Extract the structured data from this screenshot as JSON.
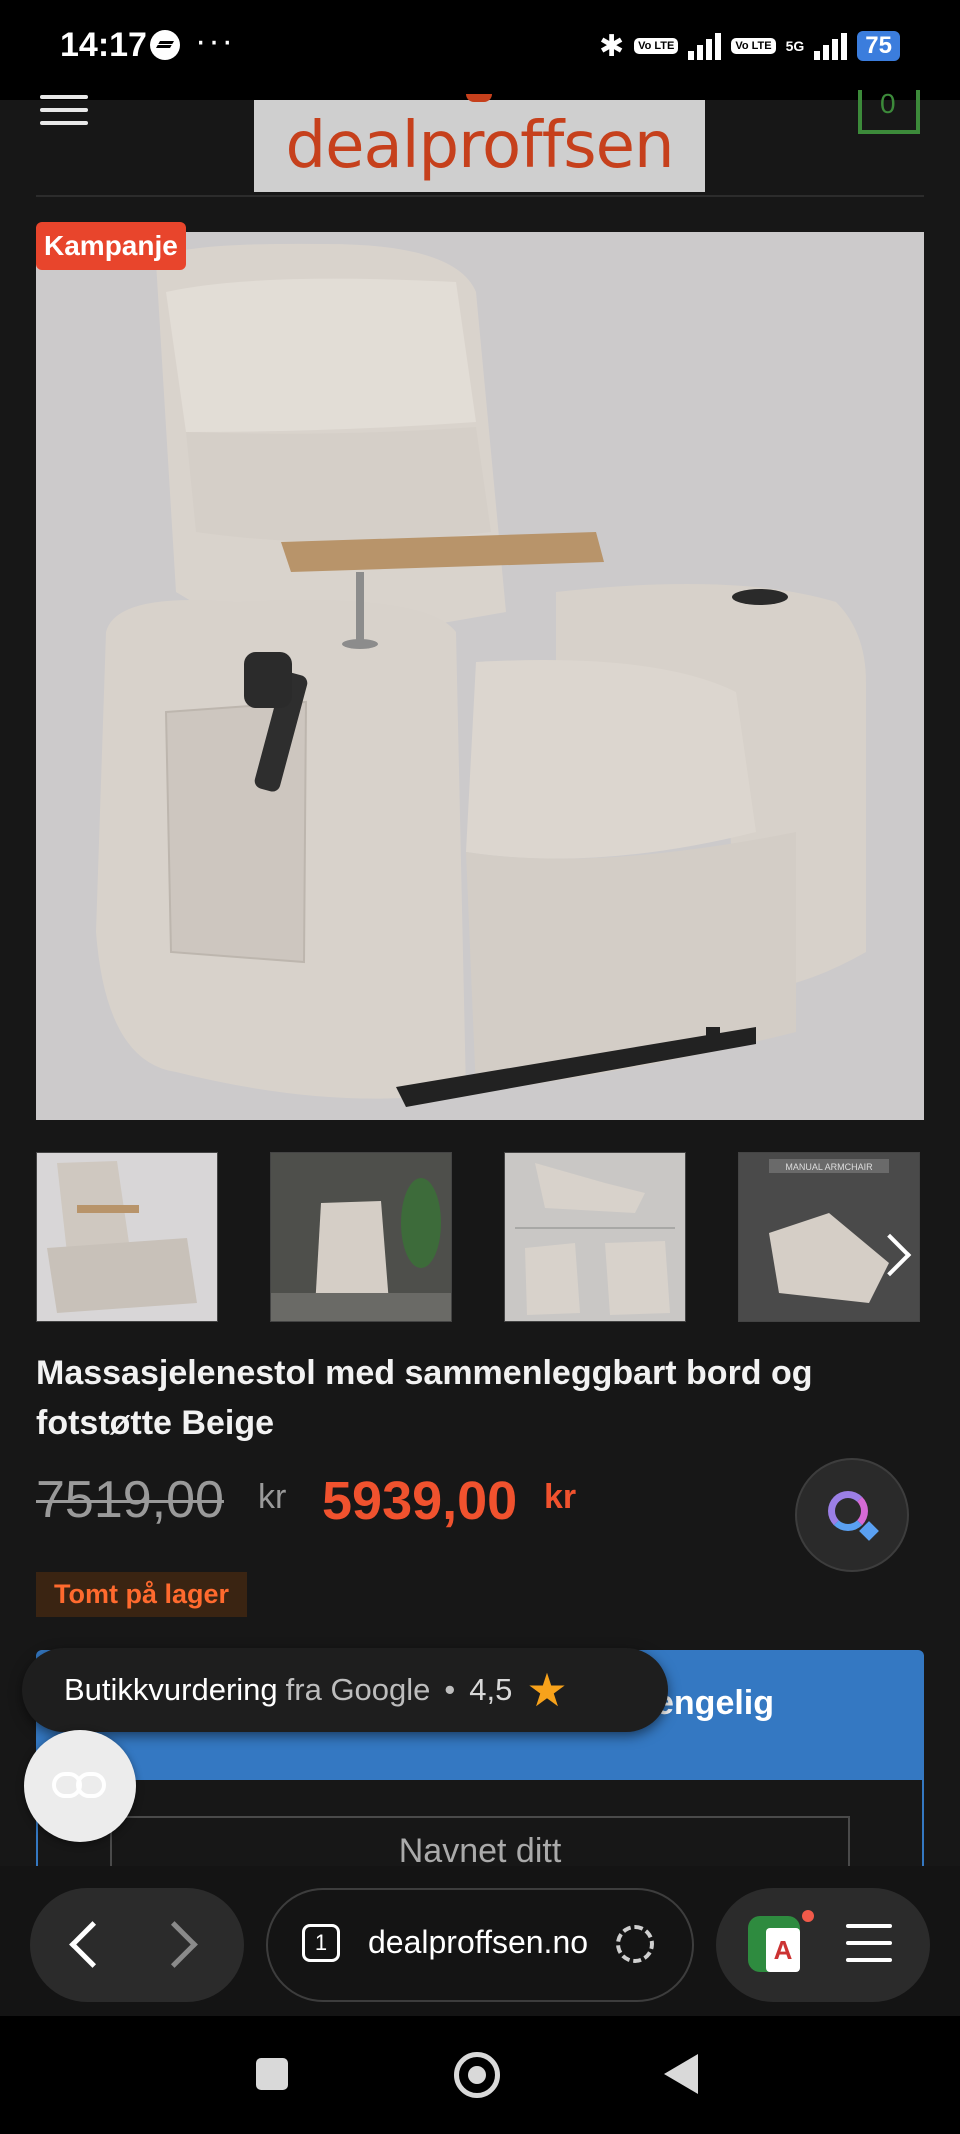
{
  "status_bar": {
    "time": "14:17",
    "more": "···",
    "signal_1": "Vo LTE",
    "signal_2": "Vo LTE",
    "network": "5G",
    "battery": "75"
  },
  "site": {
    "logo_text": "dealproffsen",
    "cart_count": "0"
  },
  "product": {
    "badge": "Kampanje",
    "title": "Massasjelenestol med sammenleggbart bord og fotstøtte Beige",
    "price_old": "7519,00",
    "price_old_currency": "kr",
    "price_new": "5939,00",
    "price_new_currency": "kr",
    "stock_status": "Tomt på lager",
    "thumb_label_4": "MANUAL ARMCHAIR"
  },
  "notify_panel": {
    "title_visible": "engelig",
    "name_placeholder": "Navnet ditt"
  },
  "google_rating": {
    "label": "Butikkvurdering",
    "source": "fra Google",
    "separator": "•",
    "score": "4,5"
  },
  "browser": {
    "tab_count": "1",
    "url": "dealproffsen.no"
  },
  "colors": {
    "accent_sale": "#e8452c",
    "price_new": "#f0522e",
    "panel_blue": "#3478c2",
    "logo": "#c6401c",
    "star": "#f7a21b"
  }
}
